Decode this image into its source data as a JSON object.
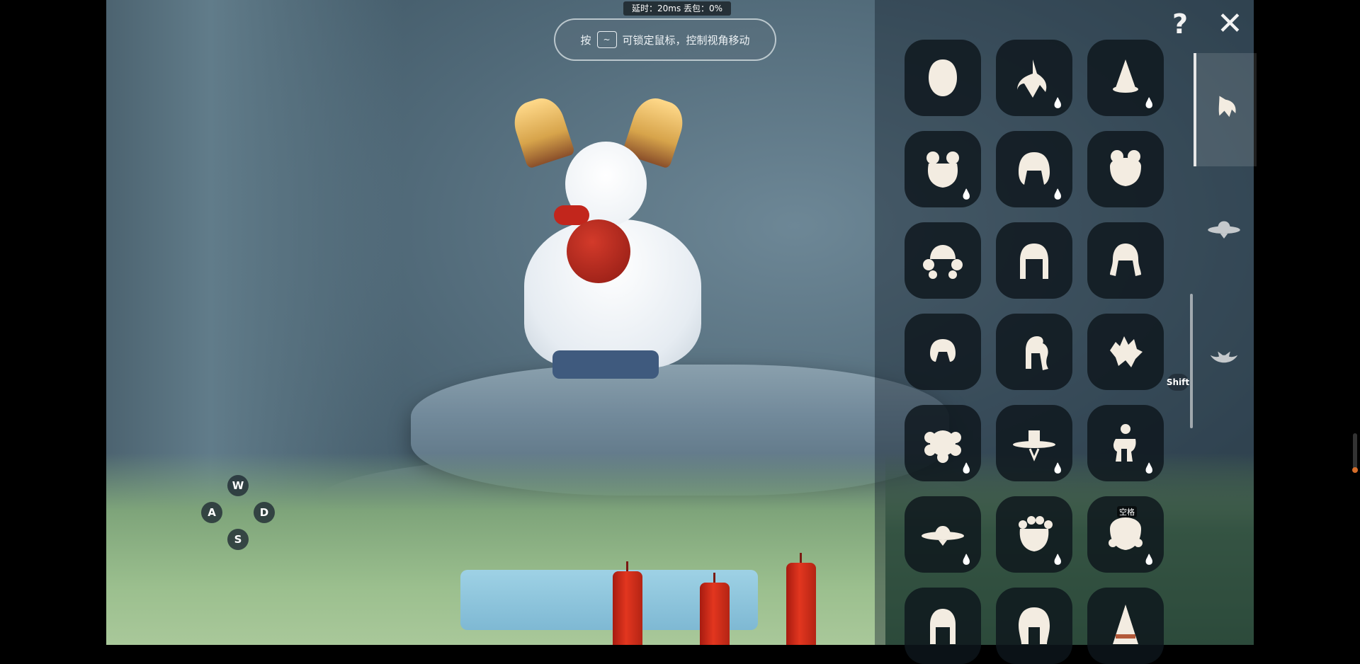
{
  "status_bar": {
    "text": "延时：20ms   丢包：0%"
  },
  "hint": {
    "prefix": "按",
    "key": "~",
    "suffix": "可锁定鼠标，控制视角移动"
  },
  "movement_keys": {
    "w": "W",
    "a": "A",
    "s": "S",
    "d": "D"
  },
  "shift_label": "Shift",
  "top_buttons": {
    "help": "?",
    "close": "✕"
  },
  "badge_text": "空格",
  "colors": {
    "candle": "#d52e1c",
    "panel_bg": "#14202a",
    "slot_bg": "#0e161c",
    "accent_white": "#f3ece1"
  },
  "cosmetic_items": [
    {
      "icon": "hood-icon",
      "drop": false
    },
    {
      "icon": "ponytail-hair-icon",
      "drop": true
    },
    {
      "icon": "pointed-hat-icon",
      "drop": true
    },
    {
      "icon": "twin-buns-hair-icon",
      "drop": true
    },
    {
      "icon": "bob-hair-icon",
      "drop": true
    },
    {
      "icon": "double-bun-hair-icon",
      "drop": false
    },
    {
      "icon": "braided-buns-hair-icon",
      "drop": false
    },
    {
      "icon": "long-curls-hair-icon",
      "drop": false
    },
    {
      "icon": "pigtails-hair-icon",
      "drop": false
    },
    {
      "icon": "short-bob-hair-icon",
      "drop": false
    },
    {
      "icon": "side-ponytail-hair-icon",
      "drop": false
    },
    {
      "icon": "spiky-hair-icon",
      "drop": false
    },
    {
      "icon": "curly-mane-hair-icon",
      "drop": true
    },
    {
      "icon": "wide-brim-hat-icon",
      "drop": true
    },
    {
      "icon": "top-knot-hair-icon",
      "drop": true
    },
    {
      "icon": "saucer-hat-icon",
      "drop": true
    },
    {
      "icon": "flower-crown-hair-icon",
      "drop": true
    },
    {
      "icon": "bun-ribbon-hair-icon",
      "drop": true,
      "badge": true
    },
    {
      "icon": "braid-hair-icon",
      "drop": false
    },
    {
      "icon": "wavy-long-hair-icon",
      "drop": false
    },
    {
      "icon": "wizard-hat-icon",
      "drop": false
    }
  ],
  "category_tabs": [
    {
      "icon": "hair-tab-icon",
      "active": true
    },
    {
      "icon": "hat-tab-icon",
      "active": false
    },
    {
      "icon": "horns-tab-icon",
      "active": false
    }
  ]
}
